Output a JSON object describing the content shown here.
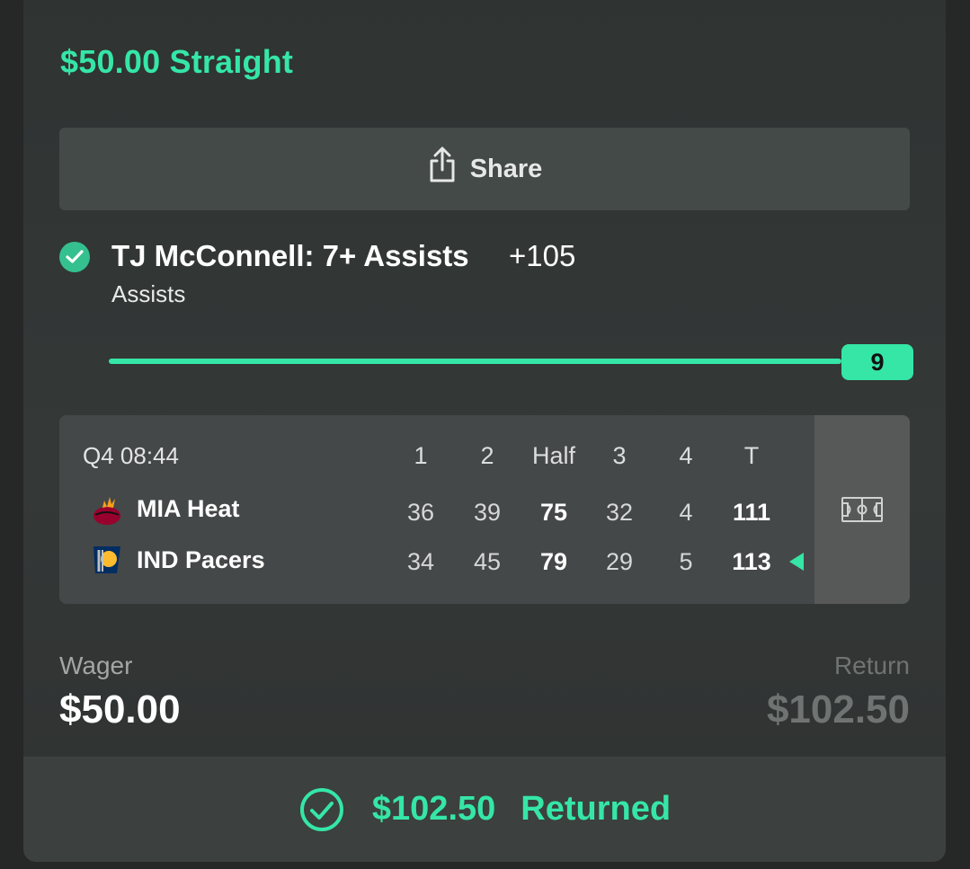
{
  "bet": {
    "title": "$50.00 Straight"
  },
  "share": {
    "label": "Share",
    "icon": "share-icon"
  },
  "leg": {
    "status_icon": "check-circle-icon",
    "title": "TJ McConnell: 7+ Assists",
    "odds": "+105",
    "market": "Assists",
    "progress": {
      "value": "9",
      "fill_fraction": 1.0
    }
  },
  "scoreboard": {
    "clock": "Q4  08:44",
    "headers": [
      "1",
      "2",
      "Half",
      "3",
      "4",
      "T"
    ],
    "teams": [
      {
        "name": "MIA Heat",
        "logo_icon": "miami-heat-logo-icon",
        "scores": [
          "36",
          "39",
          "75",
          "32",
          "4",
          "111"
        ],
        "winner": false
      },
      {
        "name": "IND Pacers",
        "logo_icon": "indiana-pacers-logo-icon",
        "scores": [
          "34",
          "45",
          "79",
          "29",
          "5",
          "113"
        ],
        "winner": true
      }
    ],
    "court_icon": "basketball-court-icon"
  },
  "summary": {
    "wager_label": "Wager",
    "wager_value": "$50.00",
    "return_label": "Return",
    "return_value": "$102.50"
  },
  "result": {
    "icon": "check-circle-outline-icon",
    "amount": "$102.50",
    "label": "Returned"
  },
  "colors": {
    "accent": "#35e6a7",
    "card_bg": "#343837",
    "page_bg": "#262727"
  }
}
